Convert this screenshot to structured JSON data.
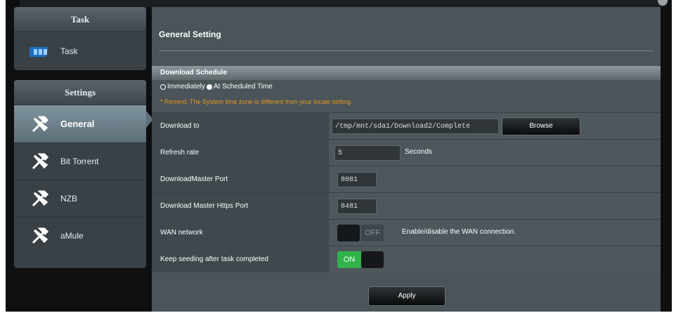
{
  "sidebar": {
    "task_header": "Task",
    "task_item": "Task",
    "settings_header": "Settings",
    "items": [
      {
        "label": "General",
        "icon": "tools-icon"
      },
      {
        "label": "Bit Torrent",
        "icon": "tools-icon"
      },
      {
        "label": "NZB",
        "icon": "tools-icon"
      },
      {
        "label": "aMule",
        "icon": "tools-icon"
      }
    ]
  },
  "main": {
    "title": "General Setting",
    "section_title": "Download Schedule",
    "schedule_option_1": "Immediately",
    "schedule_option_2": "At Scheduled Time",
    "remind": "* Remind:  The System time zone is different from your locale setting.",
    "rows": {
      "download_to_label": "Download to",
      "download_to_value": "/tmp/mnt/sda1/Download2/Complete",
      "browse_label": "Browse",
      "refresh_label": "Refresh rate",
      "refresh_value": "5",
      "refresh_unit": "Seconds",
      "dm_port_label": "DownloadMaster Port",
      "dm_port_value": "8081",
      "https_port_label": "Download Master Https Port",
      "https_port_value": "8481",
      "wan_label": "WAN network",
      "wan_toggle": "OFF",
      "wan_desc": "Enable/disable the WAN connection.",
      "seed_label": "Keep seeding after task completed",
      "seed_toggle": "ON"
    },
    "apply_label": "Apply"
  },
  "colors": {
    "accent_on": "#2fb34a",
    "remind": "#e59a1f",
    "active_item": "#6f838e"
  }
}
